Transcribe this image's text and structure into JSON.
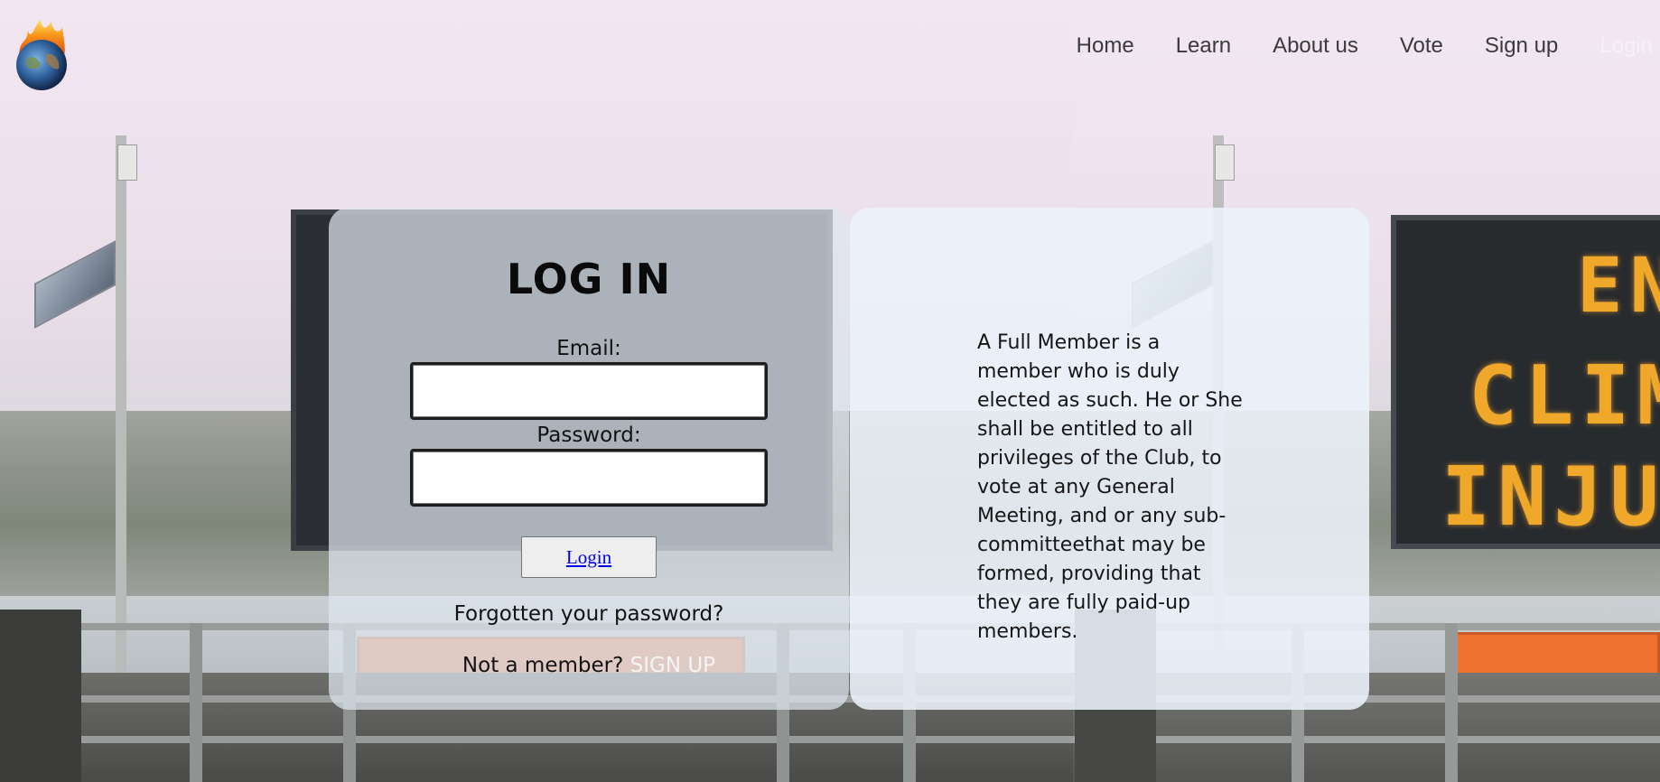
{
  "header": {
    "logo_alt": "burning earth logo",
    "nav": [
      {
        "label": "Home",
        "current": false
      },
      {
        "label": "Learn",
        "current": false
      },
      {
        "label": "About us",
        "current": false
      },
      {
        "label": "Vote",
        "current": false
      },
      {
        "label": "Sign up",
        "current": false
      },
      {
        "label": "Login",
        "current": true
      }
    ]
  },
  "login": {
    "title": "LOG IN",
    "email_label": "Email:",
    "email_value": "",
    "password_label": "Password:",
    "password_value": "",
    "button_label": "Login",
    "forgot_text": "Forgotten your password?",
    "not_member_text": "Not a member?",
    "signup_link": "SIGN UP"
  },
  "info": {
    "text": "A Full Member is a member who is duly elected as such. He or She shall be entitled to all privileges of the Club, to vote at any General Meeting, and or any sub-committeethat may be formed, providing that they are fully paid-up members."
  },
  "background": {
    "sign_lines_right": [
      "EN",
      "CLIM",
      "INJUS"
    ]
  },
  "colors": {
    "nav_text": "#3a3a3a",
    "nav_current": "#f5f1f4",
    "link_blue": "#0000ee",
    "sign_amber": "#f0a31e"
  }
}
